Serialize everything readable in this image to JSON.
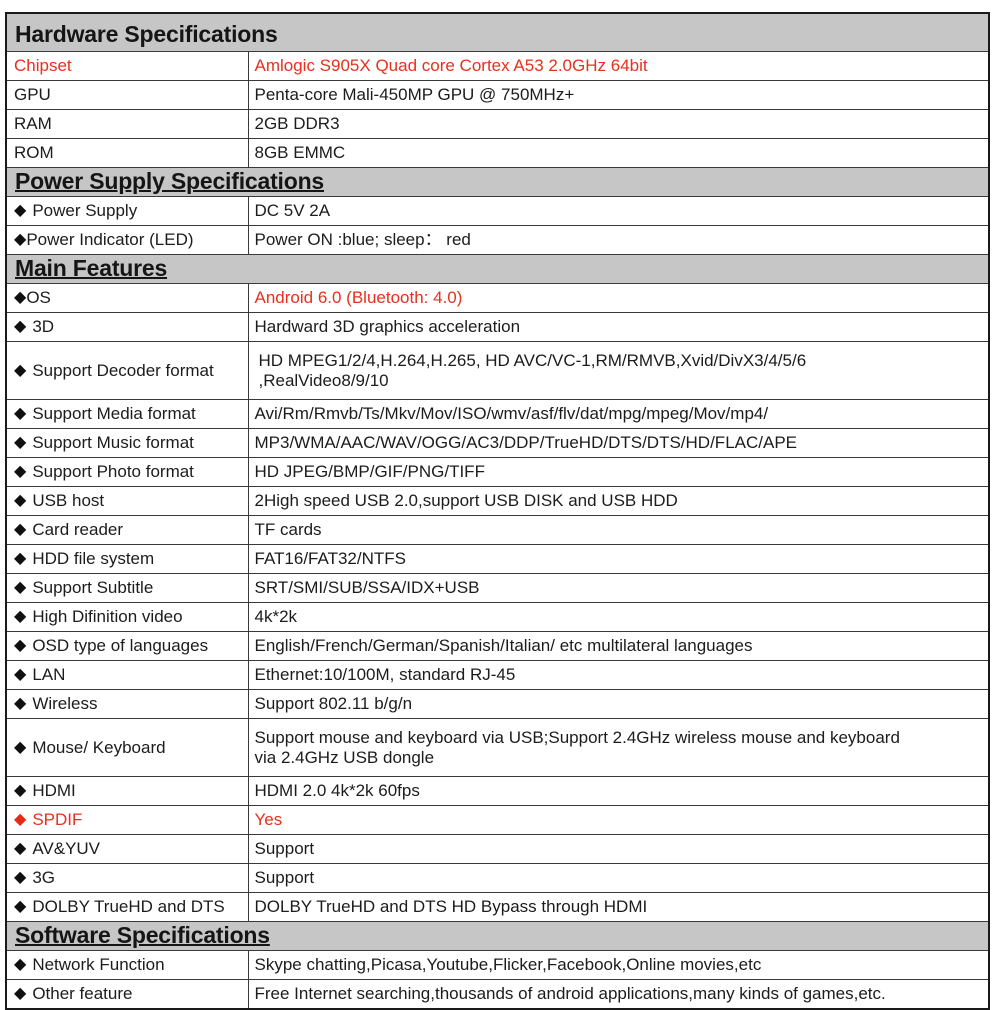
{
  "colors": {
    "section_header_bg": "#c6c6c6",
    "accent_red": "#e8301c",
    "text": "#1c1c1c",
    "border": "#3a3a3a"
  },
  "icons": {
    "bullet": "◆"
  },
  "sections": [
    {
      "title": "Hardware Specifications",
      "style": "tall",
      "rows": [
        {
          "label": "Chipset",
          "bullet": false,
          "label_red": true,
          "value": "Amlogic S905X Quad core Cortex A53 2.0GHz 64bit",
          "value_red": true
        },
        {
          "label": "GPU",
          "bullet": false,
          "label_red": false,
          "value": "Penta-core Mali-450MP GPU @ 750MHz+",
          "value_red": false
        },
        {
          "label": "RAM",
          "bullet": false,
          "label_red": false,
          "value": "2GB  DDR3",
          "value_red": false
        },
        {
          "label": "ROM",
          "bullet": false,
          "label_red": false,
          "value": "8GB  EMMC",
          "value_red": false
        }
      ]
    },
    {
      "title": "Power Supply Specifications",
      "style": "short",
      "rows": [
        {
          "label": "Power Supply",
          "bullet": true,
          "bullet_gap": true,
          "label_red": false,
          "value": "DC 5V 2A",
          "value_red": false
        },
        {
          "label": "Power Indicator (LED)",
          "bullet": true,
          "bullet_gap": false,
          "label_red": false,
          "value": "Power ON :blue; sleep：  red",
          "value_red": false
        }
      ]
    },
    {
      "title": "Main Features",
      "style": "short",
      "rows": [
        {
          "label": "OS",
          "bullet": true,
          "bullet_gap": false,
          "label_red": false,
          "value": "Android 6.0 (Bluetooth: 4.0)",
          "value_red": true
        },
        {
          "label": "3D",
          "bullet": true,
          "bullet_gap": true,
          "label_red": false,
          "value": "Hardward 3D graphics acceleration",
          "value_red": false
        },
        {
          "label": "Support Decoder format",
          "bullet": true,
          "bullet_gap": true,
          "label_red": false,
          "value": " HD MPEG1/2/4,H.264,H.265, HD AVC/VC-1,RM/RMVB,Xvid/DivX3/4/5/6",
          "value_line2": ",RealVideo8/9/10",
          "value_red": false,
          "two_line": true,
          "value_indent": true
        },
        {
          "label": "Support Media format",
          "bullet": true,
          "bullet_gap": true,
          "label_red": false,
          "value": "Avi/Rm/Rmvb/Ts/Mkv/Mov/ISO/wmv/asf/flv/dat/mpg/mpeg/Mov/mp4/",
          "value_red": false
        },
        {
          "label": "Support Music format",
          "bullet": true,
          "bullet_gap": true,
          "label_red": false,
          "value": "MP3/WMA/AAC/WAV/OGG/AC3/DDP/TrueHD/DTS/DTS/HD/FLAC/APE",
          "value_red": false
        },
        {
          "label": "Support Photo format",
          "bullet": true,
          "bullet_gap": true,
          "label_red": false,
          "value": "HD JPEG/BMP/GIF/PNG/TIFF",
          "value_red": false
        },
        {
          "label": "USB host",
          "bullet": true,
          "bullet_gap": true,
          "label_red": false,
          "value": "2High speed USB 2.0,support USB DISK and USB HDD",
          "value_red": false
        },
        {
          "label": "Card reader",
          "bullet": true,
          "bullet_gap": true,
          "label_red": false,
          "value": "TF cards",
          "value_red": false
        },
        {
          "label": "HDD file system",
          "bullet": true,
          "bullet_gap": true,
          "label_red": false,
          "value": "FAT16/FAT32/NTFS",
          "value_red": false
        },
        {
          "label": "Support Subtitle",
          "bullet": true,
          "bullet_gap": true,
          "label_red": false,
          "value": "SRT/SMI/SUB/SSA/IDX+USB",
          "value_red": false
        },
        {
          "label": "High Difinition video",
          "bullet": true,
          "bullet_gap": true,
          "label_red": false,
          "value": "4k*2k",
          "value_red": false
        },
        {
          "label": "OSD type of languages",
          "bullet": true,
          "bullet_gap": true,
          "label_red": false,
          "value": "English/French/German/Spanish/Italian/ etc multilateral languages",
          "value_red": false
        },
        {
          "label": "LAN",
          "bullet": true,
          "bullet_gap": true,
          "label_red": false,
          "value": "Ethernet:10/100M, standard RJ-45",
          "value_red": false
        },
        {
          "label": "Wireless",
          "bullet": true,
          "bullet_gap": true,
          "label_red": false,
          "value": "Support 802.11 b/g/n",
          "value_red": false
        },
        {
          "label": "Mouse/ Keyboard",
          "bullet": true,
          "bullet_gap": true,
          "label_red": false,
          "value": "Support mouse and keyboard via USB;Support 2.4GHz wireless mouse and keyboard",
          "value_line2": "via 2.4GHz USB dongle",
          "value_red": false,
          "two_line": true
        },
        {
          "label": "HDMI",
          "bullet": true,
          "bullet_gap": true,
          "label_red": false,
          "value": "HDMI 2.0 4k*2k 60fps",
          "value_red": false
        },
        {
          "label": "SPDIF",
          "bullet": true,
          "bullet_gap": true,
          "bullet_red": true,
          "label_red": true,
          "value": "Yes",
          "value_red": true
        },
        {
          "label": "AV&YUV",
          "bullet": true,
          "bullet_gap": true,
          "label_red": false,
          "value": "Support",
          "value_red": false
        },
        {
          "label": "3G",
          "bullet": true,
          "bullet_gap": true,
          "label_red": false,
          "value": "Support",
          "value_red": false
        },
        {
          "label": "DOLBY TrueHD and DTS",
          "bullet": true,
          "bullet_gap": true,
          "label_red": false,
          "value": "DOLBY TrueHD and DTS HD Bypass through HDMI",
          "value_red": false
        }
      ]
    },
    {
      "title": "Software Specifications",
      "style": "short",
      "rows": [
        {
          "label": "Network Function",
          "bullet": true,
          "bullet_gap": true,
          "label_red": false,
          "value": "Skype chatting,Picasa,Youtube,Flicker,Facebook,Online movies,etc",
          "value_red": false
        },
        {
          "label": "Other feature",
          "bullet": true,
          "bullet_gap": true,
          "label_red": false,
          "value": "Free Internet searching,thousands of android applications,many kinds of games,etc.",
          "value_red": false
        }
      ]
    }
  ]
}
